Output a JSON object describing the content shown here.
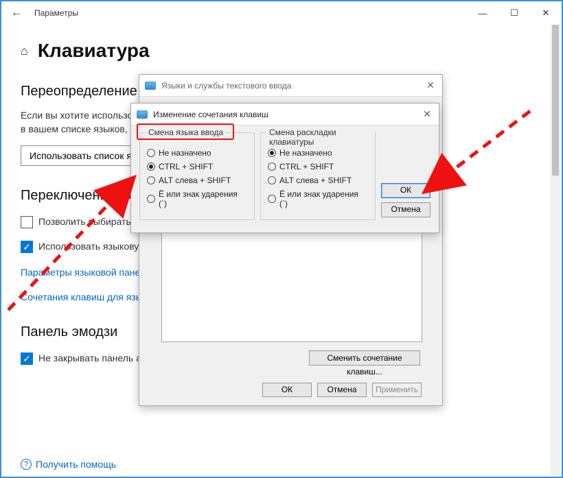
{
  "window": {
    "app_title": "Параметры",
    "controls": {
      "min": "—",
      "max": "☐",
      "close": "✕"
    },
    "back": "←"
  },
  "page": {
    "title": "Клавиатура",
    "section_override": "Переопределение метода ввода по умолчанию",
    "override_text": "Если вы хотите использовать метод ввода, отличный от указанного на первом месте в вашем списке языков, выберите его здесь",
    "use_list_btn": "Использовать список языков (рекомендуется)",
    "section_switch": "Переключение методов ввода",
    "chk_allow": "Позволить выбирать метод ввода для каждого окна приложения",
    "chk_use_bar": "Использовать языковую панель на рабочем столе, если она доступна",
    "link_panel": "Параметры языковой панели",
    "link_hotkeys": "Сочетания клавиш для языков ввода",
    "section_emoji": "Панель эмодзи",
    "chk_emoji": "Не закрывать панель автоматически после ввода эмодзи",
    "help": "Получить помощь"
  },
  "dlg1": {
    "title": "Языки и службы текстового ввода",
    "change_btn": "Сменить сочетание клавиш...",
    "ok": "ОК",
    "cancel": "Отмена",
    "apply": "Применить"
  },
  "dlg2": {
    "title": "Изменение сочетания клавиш",
    "group_lang": "Смена языка ввода",
    "group_layout": "Смена раскладки клавиатуры",
    "opt_none": "Не назначено",
    "opt_ctrl": "CTRL + SHIFT",
    "opt_alt": "ALT слева + SHIFT",
    "opt_tilde": "Ё или знак ударения (`)",
    "ok": "ОК",
    "cancel": "Отмена",
    "lang_selected": "CTRL + SHIFT",
    "layout_selected": "Не назначено"
  }
}
